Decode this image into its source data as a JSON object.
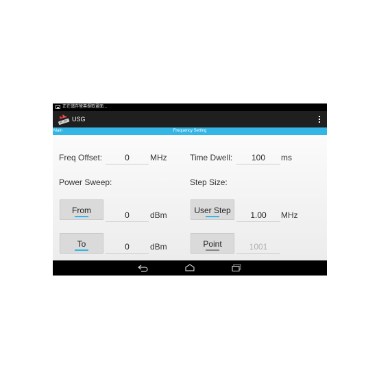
{
  "status_bar": {
    "notification_text": "正在儲存螢幕擷取畫面..."
  },
  "action_bar": {
    "title": "USG",
    "app_icon": "app-icon",
    "menu_icon": "overflow-menu-icon"
  },
  "tabs": {
    "main": "Main",
    "current": "Frequency Setting"
  },
  "form": {
    "freq_offset": {
      "label": "Freq Offset:",
      "value": "0",
      "unit": "MHz"
    },
    "time_dwell": {
      "label": "Time Dwell:",
      "value": "100",
      "unit": "ms"
    },
    "power_sweep_label": "Power Sweep:",
    "step_size_label": "Step Size:",
    "from": {
      "button": "From",
      "value": "0",
      "unit": "dBm"
    },
    "to": {
      "button": "To",
      "value": "0",
      "unit": "dBm"
    },
    "user_step": {
      "button": "User Step",
      "value": "1.00",
      "unit": "MHz"
    },
    "point": {
      "button": "Point",
      "value": "1001"
    }
  },
  "nav_bar": {
    "back": "back-icon",
    "home": "home-icon",
    "recents": "recents-icon"
  },
  "colors": {
    "accent": "#33b5e5",
    "action_bar": "#1f1f1f",
    "status_bar": "#000000"
  }
}
